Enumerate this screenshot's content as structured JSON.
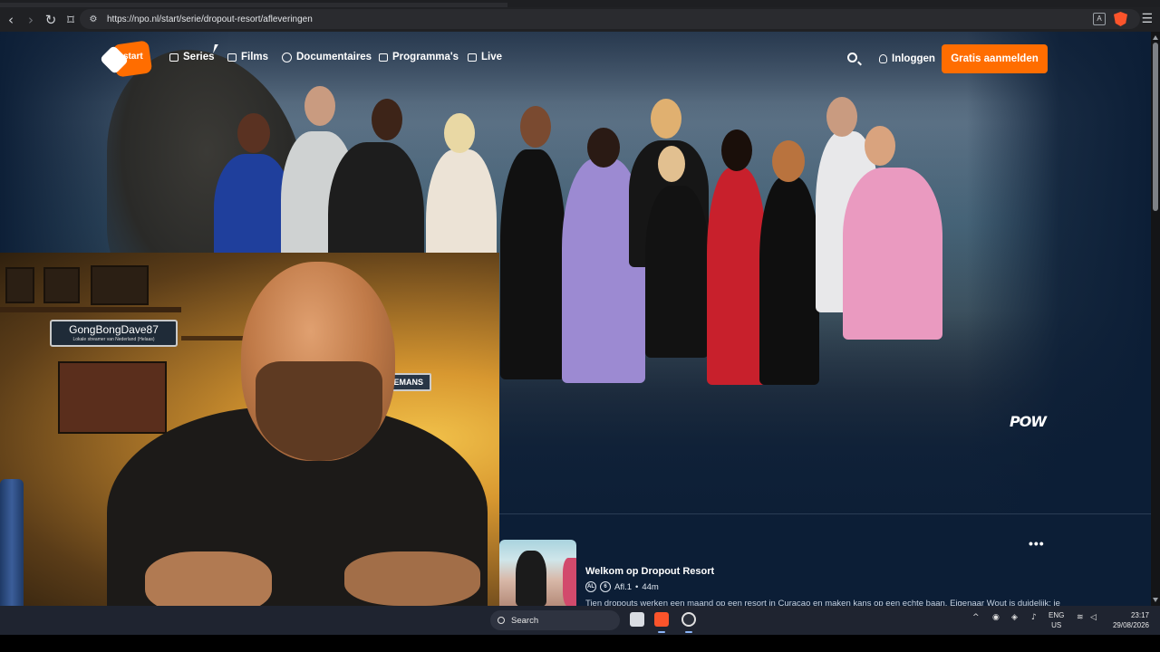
{
  "browser": {
    "url": "https://npo.nl/start/serie/dropout-resort/afleveringen",
    "menu_glyph": "☰"
  },
  "site": {
    "logo_text": "start",
    "nav": [
      {
        "label": "Series",
        "icon": "series-icon"
      },
      {
        "label": "Films",
        "icon": "film-icon"
      },
      {
        "label": "Documentaires",
        "icon": "documentary-icon"
      },
      {
        "label": "Programma's",
        "icon": "tv-icon"
      },
      {
        "label": "Live",
        "icon": "live-icon"
      }
    ],
    "login_label": "Inloggen",
    "signup_label": "Gratis aanmelden",
    "accent_color": "#ff6d00",
    "broadcaster": "POW"
  },
  "episode": {
    "title": "Welkom op Dropout Resort",
    "number": "Afl.1",
    "separator": "•",
    "duration": "44m",
    "rating_badges": [
      "AL",
      "6"
    ],
    "description": "Tien dropouts werken een maand op een resort in Curaçao en maken kans op een echte baan. Eigenaar Wout is duidelijk: je",
    "more_label": "•••"
  },
  "webcam": {
    "sign_name": "GongBongDave87",
    "sign_sub": "Lokale streamer van Nederland (Helaas)",
    "sign2": "LEEMANS"
  },
  "taskbar": {
    "search_label": "Search",
    "lang_top": "ENG",
    "lang_bottom": "US",
    "time": "23:17",
    "date": "29/08/2026"
  }
}
